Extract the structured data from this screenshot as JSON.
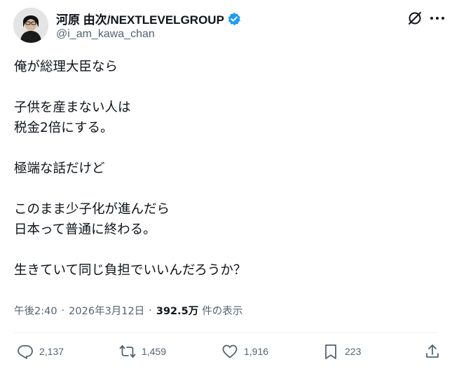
{
  "author": {
    "name": "河原 由次/NEXTLEVELGROUP",
    "handle": "@i_am_kawa_chan",
    "verified": true
  },
  "tweet": {
    "lines": [
      "俺が総理大臣なら",
      "",
      "子供を産まない人は",
      "税金2倍にする。",
      "",
      "極端な話だけど",
      "",
      "このまま少子化が進んだら",
      "日本って普通に終わる。",
      "",
      "生きていて同じ負担でいいんだろうか？"
    ]
  },
  "meta": {
    "time": "午後2:40",
    "separator": "·",
    "date": "2026年3月12日",
    "views": "392.5万",
    "views_label": "件の表示"
  },
  "actions": {
    "replies": "2,137",
    "reposts": "1,459",
    "likes": "1,916",
    "bookmarks": "223"
  },
  "colors": {
    "text": "#0f1419",
    "secondary": "#536471",
    "verified": "#1d9bf0",
    "divider": "#eff3f4"
  },
  "icons": [
    "verified-badge-icon",
    "grok-icon",
    "more-icon",
    "reply-icon",
    "repost-icon",
    "like-icon",
    "bookmark-icon",
    "share-icon"
  ]
}
